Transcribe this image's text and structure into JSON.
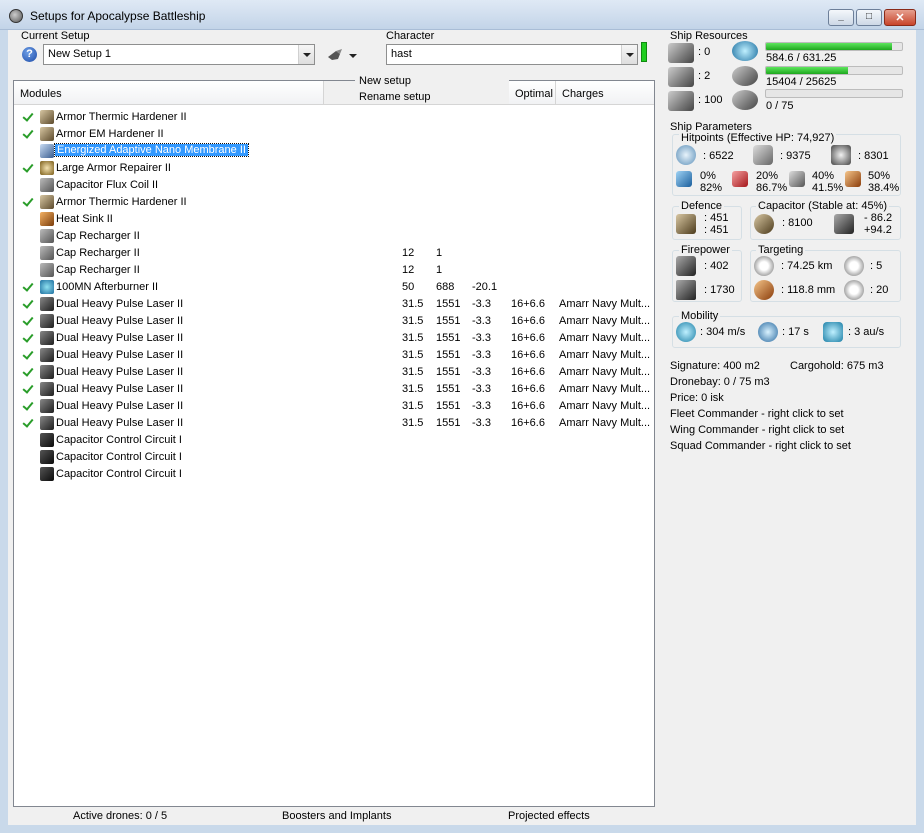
{
  "window": {
    "title": "Setups for Apocalypse Battleship"
  },
  "setup": {
    "current_label": "Current Setup",
    "current_value": "New Setup 1",
    "character_label": "Character",
    "character_value": "hast"
  },
  "context_menu": {
    "new_setup": "New setup",
    "rename_setup": "Rename setup"
  },
  "columns": {
    "modules": "Modules",
    "optimal": "Optimal",
    "charges": "Charges"
  },
  "modules": [
    {
      "active": true,
      "name": "Armor Thermic Hardener II",
      "icon": "hardener-icon",
      "c1": "",
      "c2": "",
      "c3": "",
      "optimal": "",
      "charges": ""
    },
    {
      "active": true,
      "name": "Armor EM Hardener II",
      "icon": "hardener-icon",
      "c1": "",
      "c2": "",
      "c3": "",
      "optimal": "",
      "charges": ""
    },
    {
      "active": false,
      "name": "Energized Adaptive Nano Membrane II",
      "icon": "membrane-icon",
      "selected": true,
      "c1": "",
      "c2": "",
      "c3": "",
      "optimal": "",
      "charges": ""
    },
    {
      "active": true,
      "name": "Large Armor Repairer II",
      "icon": "repairer-icon",
      "c1": "",
      "c2": "",
      "c3": "",
      "optimal": "",
      "charges": ""
    },
    {
      "active": false,
      "name": "Capacitor Flux Coil II",
      "icon": "capacitor-icon",
      "c1": "",
      "c2": "",
      "c3": "",
      "optimal": "",
      "charges": ""
    },
    {
      "active": true,
      "name": "Armor Thermic Hardener II",
      "icon": "hardener-icon",
      "c1": "",
      "c2": "",
      "c3": "",
      "optimal": "",
      "charges": ""
    },
    {
      "active": false,
      "name": "Heat Sink II",
      "icon": "heat-sink-icon",
      "c1": "",
      "c2": "",
      "c3": "",
      "optimal": "",
      "charges": ""
    },
    {
      "active": false,
      "name": "Cap Recharger II",
      "icon": "capacitor-icon",
      "c1": "",
      "c2": "",
      "c3": "",
      "optimal": "",
      "charges": ""
    },
    {
      "active": false,
      "name": "Cap Recharger II",
      "icon": "capacitor-icon",
      "c1": "12",
      "c2": "1",
      "c3": "",
      "optimal": "",
      "charges": ""
    },
    {
      "active": false,
      "name": "Cap Recharger II",
      "icon": "capacitor-icon",
      "c1": "12",
      "c2": "1",
      "c3": "",
      "optimal": "",
      "charges": ""
    },
    {
      "active": true,
      "name": "100MN Afterburner II",
      "icon": "afterburner-icon",
      "c1": "50",
      "c2": "688",
      "c3": "-20.1",
      "optimal": "",
      "charges": ""
    },
    {
      "active": true,
      "name": "Dual Heavy Pulse Laser II",
      "icon": "laser-icon",
      "c1": "31.5",
      "c2": "1551",
      "c3": "-3.3",
      "optimal": "16+6.6",
      "charges": "Amarr Navy Mult..."
    },
    {
      "active": true,
      "name": "Dual Heavy Pulse Laser II",
      "icon": "laser-icon",
      "c1": "31.5",
      "c2": "1551",
      "c3": "-3.3",
      "optimal": "16+6.6",
      "charges": "Amarr Navy Mult..."
    },
    {
      "active": true,
      "name": "Dual Heavy Pulse Laser II",
      "icon": "laser-icon",
      "c1": "31.5",
      "c2": "1551",
      "c3": "-3.3",
      "optimal": "16+6.6",
      "charges": "Amarr Navy Mult..."
    },
    {
      "active": true,
      "name": "Dual Heavy Pulse Laser II",
      "icon": "laser-icon",
      "c1": "31.5",
      "c2": "1551",
      "c3": "-3.3",
      "optimal": "16+6.6",
      "charges": "Amarr Navy Mult..."
    },
    {
      "active": true,
      "name": "Dual Heavy Pulse Laser II",
      "icon": "laser-icon",
      "c1": "31.5",
      "c2": "1551",
      "c3": "-3.3",
      "optimal": "16+6.6",
      "charges": "Amarr Navy Mult..."
    },
    {
      "active": true,
      "name": "Dual Heavy Pulse Laser II",
      "icon": "laser-icon",
      "c1": "31.5",
      "c2": "1551",
      "c3": "-3.3",
      "optimal": "16+6.6",
      "charges": "Amarr Navy Mult..."
    },
    {
      "active": true,
      "name": "Dual Heavy Pulse Laser II",
      "icon": "laser-icon",
      "c1": "31.5",
      "c2": "1551",
      "c3": "-3.3",
      "optimal": "16+6.6",
      "charges": "Amarr Navy Mult..."
    },
    {
      "active": true,
      "name": "Dual Heavy Pulse Laser II",
      "icon": "laser-icon",
      "c1": "31.5",
      "c2": "1551",
      "c3": "-3.3",
      "optimal": "16+6.6",
      "charges": "Amarr Navy Mult..."
    },
    {
      "active": false,
      "name": "Capacitor Control Circuit I",
      "icon": "rig-icon",
      "c1": "",
      "c2": "",
      "c3": "",
      "optimal": "",
      "charges": ""
    },
    {
      "active": false,
      "name": "Capacitor Control Circuit I",
      "icon": "rig-icon",
      "c1": "",
      "c2": "",
      "c3": "",
      "optimal": "",
      "charges": ""
    },
    {
      "active": false,
      "name": "Capacitor Control Circuit I",
      "icon": "rig-icon",
      "c1": "",
      "c2": "",
      "c3": "",
      "optimal": "",
      "charges": ""
    }
  ],
  "footer": {
    "drones": "Active drones: 0 / 5",
    "boosters": "Boosters and Implants",
    "projected": "Projected effects"
  },
  "resources": {
    "title": "Ship Resources",
    "turrets": ": 0",
    "launchers": ": 2",
    "calibration": ": 100",
    "cpu": "584.6 / 631.25",
    "cpu_fraction": 0.926,
    "powergrid": "15404 / 25625",
    "powergrid_fraction": 0.601,
    "drones": "0 / 75",
    "drones_fraction": 0
  },
  "params": {
    "title": "Ship Parameters",
    "hitpoints_title": "Hitpoints (Effective HP: 74,927)",
    "shield_hp": ": 6522",
    "armor_hp": ": 9375",
    "structure_hp": ": 8301",
    "em_a": "0%",
    "em_b": "82%",
    "thermal_a": "20%",
    "thermal_b": "86.7%",
    "kinetic_a": "40%",
    "kinetic_b": "41.5%",
    "explosive_a": "50%",
    "explosive_b": "38.4%",
    "defence_title": "Defence",
    "defence_a": ": 451",
    "defence_b": ": 451",
    "capacitor_title": "Capacitor (Stable at: 45%)",
    "capacitor_value": ": 8100",
    "capacitor_a": "- 86.2",
    "capacitor_b": "+94.2",
    "firepower_title": "Firepower",
    "firepower_a": ": 402",
    "firepower_b": ": 1730",
    "targeting_title": "Targeting",
    "range": ": 74.25 km",
    "max_targets": ": 5",
    "scan_res": ": 118.8 mm",
    "sensor": ": 20",
    "mobility_title": "Mobility",
    "speed": ": 304 m/s",
    "align": ": 17 s",
    "warp": ": 3 au/s",
    "signature": "Signature: 400 m2",
    "cargohold": "Cargohold: 675 m3",
    "dronebay": "Dronebay: 0 / 75 m3",
    "price": "Price: 0 isk",
    "fleet": "Fleet Commander - right click to set",
    "wing": "Wing Commander - right click to set",
    "squad": "Squad Commander - right click to set"
  }
}
